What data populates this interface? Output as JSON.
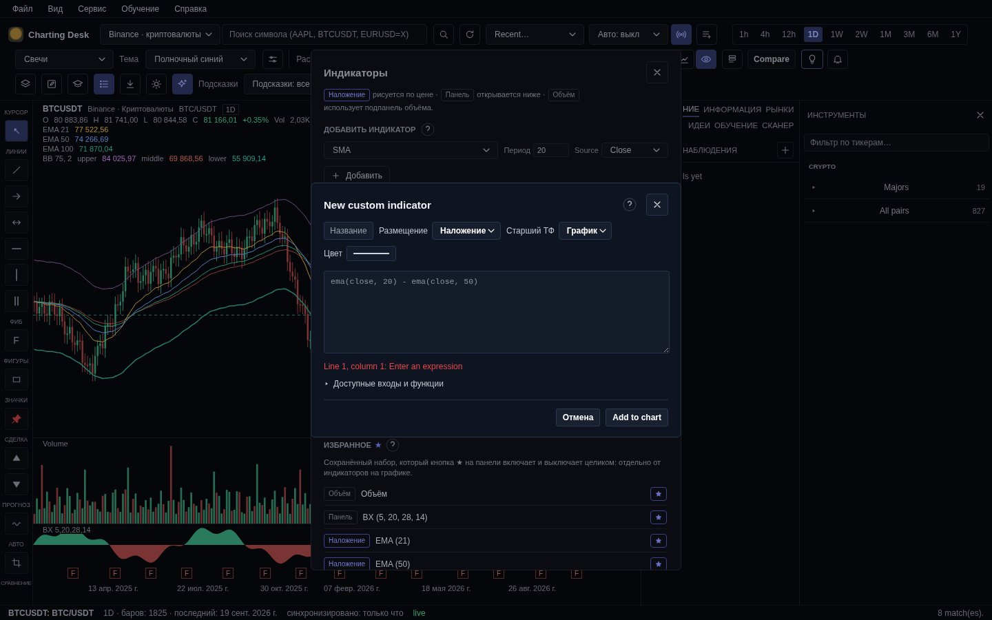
{
  "menu": [
    "Файл",
    "Вид",
    "Сервис",
    "Обучение",
    "Справка"
  ],
  "toolbar": {
    "app_name": "Charting Desk",
    "exchange": "Binance · криптовалюты",
    "search": {
      "placeholder": "Поиск символа (AAPL, BTCUSDT, EURUSD=X)"
    },
    "recent": "Recent…",
    "auto": "Авто: выкл",
    "live_stream_on": true,
    "timeframes": [
      {
        "label": "1h",
        "selected": false
      },
      {
        "label": "4h",
        "selected": false
      },
      {
        "label": "12h",
        "selected": false
      },
      {
        "label": "1D",
        "selected": true
      },
      {
        "label": "1W",
        "selected": false
      },
      {
        "label": "2W",
        "selected": false
      },
      {
        "label": "1M",
        "selected": false
      },
      {
        "label": "3M",
        "selected": false
      },
      {
        "label": "6M",
        "selected": false
      },
      {
        "label": "1Y",
        "selected": false
      }
    ]
  },
  "toolbar_row2": {
    "chart_type": "Свечи",
    "theme_label": "Тема",
    "theme": "Полночный синий",
    "cut_label": "Рас",
    "visibility_on": true,
    "compare": "Compare"
  },
  "toolbar_row3": {
    "tools": [
      {
        "kind": "layers",
        "selected": false
      },
      {
        "kind": "edit",
        "selected": false
      },
      {
        "kind": "cap",
        "selected": false
      },
      {
        "kind": "list",
        "selected": true
      },
      {
        "kind": "download",
        "selected": false
      },
      {
        "kind": "sun",
        "selected": false
      },
      {
        "kind": "sparkle",
        "selected": true
      }
    ],
    "hints_label": "Подсказки",
    "hints": "Подсказки: все"
  },
  "tool_strip": [
    {
      "label": "КУРСОР",
      "tools": [
        {
          "kind": "cursor",
          "selected": true
        }
      ]
    },
    {
      "label": "ЛИНИИ",
      "tools": [
        {
          "kind": "line",
          "selected": false
        },
        {
          "kind": "arrow",
          "selected": false
        },
        {
          "kind": "hdouble",
          "selected": false
        },
        {
          "kind": "hline",
          "selected": false
        },
        {
          "kind": "vline",
          "selected": false
        },
        {
          "kind": "parallel",
          "selected": false
        }
      ]
    },
    {
      "label": "ФИБ",
      "tools": [
        {
          "kind": "text",
          "text": "F",
          "selected": false
        }
      ]
    },
    {
      "label": "ФИГУРЫ",
      "tools": [
        {
          "kind": "rect",
          "selected": false
        }
      ]
    },
    {
      "label": "ЗНАЧКИ",
      "tools": [
        {
          "kind": "pin",
          "selected": false
        }
      ]
    },
    {
      "label": "СДЕЛКА",
      "tools": [
        {
          "kind": "up",
          "selected": false
        },
        {
          "kind": "down",
          "selected": false
        }
      ]
    },
    {
      "label": "ПРОГНОЗ",
      "tools": [
        {
          "kind": "wave",
          "selected": false
        }
      ]
    },
    {
      "label": "АВТО",
      "tools": [
        {
          "kind": "crop",
          "selected": false
        }
      ]
    },
    {
      "label": "СРАВНЕНИЕ"
    }
  ],
  "chart": {
    "symbol": "BTCUSDT",
    "exchange": "Binance · Криптовалюты",
    "pair": "BTC/USDT",
    "interval": "1D",
    "ohlc": [
      {
        "label": "O",
        "value": "80 883,86"
      },
      {
        "label": "H",
        "value": "81 741,00"
      },
      {
        "label": "L",
        "value": "80 844,58"
      },
      {
        "label": "C",
        "value": "81 166,01"
      }
    ],
    "change": "+0.35%",
    "volume_label": "Vol",
    "volume_value": "2,03K",
    "emas": [
      {
        "name": "EMA 21",
        "value": "77 522,56",
        "color": "#b08a3a"
      },
      {
        "name": "EMA 50",
        "value": "74 266,69",
        "color": "#5a7ec0"
      },
      {
        "name": "EMA 100",
        "value": "71 870,04",
        "color": "#2f9070"
      }
    ],
    "bb": {
      "name": "BB 75, 2",
      "upper_label": "upper",
      "upper": "84 025,97",
      "middle_label": "middle",
      "middle": "69 868,56",
      "lower_label": "lower",
      "lower": "55 909,14"
    },
    "volume_pane": "Volume",
    "bx_pane": "BX 5,20,28,14",
    "event_markers": [
      "F",
      "F",
      "F",
      "F",
      "F",
      "F",
      "F",
      "F",
      "F",
      "F",
      "F",
      "F",
      "F",
      "F"
    ],
    "dates": [
      "13 апр. 2025 г.",
      "22 июл. 2025 г.",
      "30 окт. 2025 г.",
      "07 февр. 2026 г.",
      "18 мая 2026 г.",
      "26 авг. 2026 г."
    ]
  },
  "watch_panel": {
    "tabs": [
      {
        "label": "НИЕ",
        "selected": true
      },
      {
        "label": "ИНФОРМАЦИЯ",
        "selected": false
      },
      {
        "label": "РЫНКИ",
        "selected": false
      },
      {
        "label": "ИДЕИ",
        "selected": false
      },
      {
        "label": "ОБУЧЕНИЕ",
        "selected": false
      },
      {
        "label": "СКАНЕР",
        "selected": false
      }
    ],
    "list_title": "НАБЛЮДЕНИЯ",
    "empty_text": "ls yet"
  },
  "instruments": {
    "title": "ИНСТРУМЕНТЫ",
    "filter": {
      "placeholder": "Фильтр по тикерам…"
    },
    "section": "CRYPTO",
    "groups": [
      {
        "name": "Majors",
        "count": "19",
        "expanded": false
      },
      {
        "name": "All pairs",
        "count": "827",
        "expanded": false
      }
    ]
  },
  "indicators_dialog": {
    "title": "Индикаторы",
    "legend": [
      {
        "tag": "Наложение",
        "kind": "overlay",
        "text": "рисуется по цене ·"
      },
      {
        "tag": "Панель",
        "kind": "pane",
        "text": "открывается ниже ·"
      },
      {
        "tag": "Объём",
        "kind": "volume",
        "text": "использует подпанель объёма."
      }
    ],
    "add_title": "ДОБАВИТЬ ИНДИКАТОР",
    "indicator": "SMA",
    "period_label": "Период",
    "period": "20",
    "source_label": "Source",
    "source": "Close",
    "add_button": "Добавить",
    "favorites_title": "ИЗБРАННОЕ",
    "favorites_star": "★",
    "favorites_text": "Сохранённый набор, который кнопка ★ на панели включает и выключает целиком: отдельно от индикаторов на графике.",
    "favorites": [
      {
        "tag": "Объём",
        "kind": "volume",
        "name": "Объём"
      },
      {
        "tag": "Панель",
        "kind": "pane",
        "name": "BX (5, 20, 28, 14)"
      },
      {
        "tag": "Наложение",
        "kind": "overlay",
        "name": "EMA (21)"
      },
      {
        "tag": "Наложение",
        "kind": "overlay",
        "name": "EMA (50)"
      }
    ]
  },
  "custom_indicator_dialog": {
    "title": "New custom indicator",
    "name_field": {
      "placeholder": "Название"
    },
    "placement_label": "Размещение",
    "placement": "Наложение",
    "htf_label": "Старший ТФ",
    "htf": "График",
    "color_label": "Цвет",
    "code": {
      "placeholder": "ema(close, 20) - ema(close, 50)"
    },
    "error": "Line 1, column 1: Enter an expression",
    "inputs_disclosure": {
      "label": "Доступные входы и функции",
      "expanded": false
    },
    "buttons": [
      "Отмена",
      "Add to chart"
    ]
  },
  "status_bar": {
    "symbol": "BTCUSDT: BTC/USDT",
    "info": "1D · баров: 1825 · последний: 19 сент. 2026 г.",
    "sync": "синхронизировано: только что",
    "live": "live",
    "matches": "8 match(es)."
  }
}
